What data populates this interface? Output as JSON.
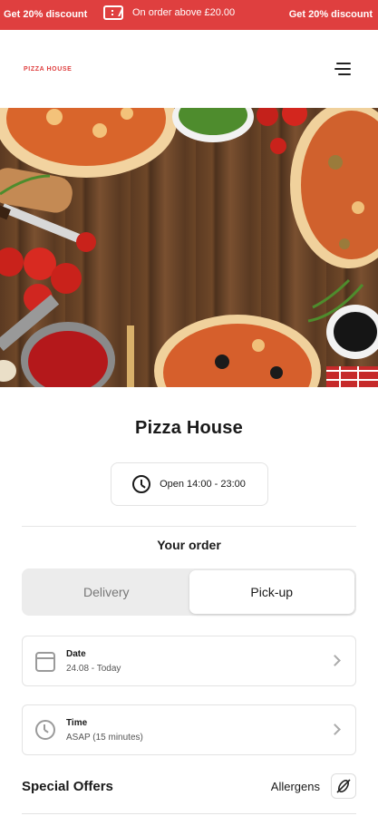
{
  "promo": {
    "left": "Get 20% discount",
    "center": "On order above £20.00",
    "right": "Get 20% discount"
  },
  "header": {
    "logo": "PIZZA HOUSE"
  },
  "restaurant": {
    "name": "Pizza House",
    "hours": "Open 14:00 - 23:00"
  },
  "order": {
    "heading": "Your order",
    "tabs": [
      {
        "label": "Delivery",
        "active": false
      },
      {
        "label": "Pick-up",
        "active": true
      }
    ],
    "date": {
      "label": "Date",
      "value": "24.08 - Today"
    },
    "time": {
      "label": "Time",
      "value": "ASAP (15 minutes)"
    }
  },
  "sections": {
    "special_offers": "Special Offers",
    "allergens": "Allergens"
  },
  "colors": {
    "accent": "#df3f3f"
  }
}
